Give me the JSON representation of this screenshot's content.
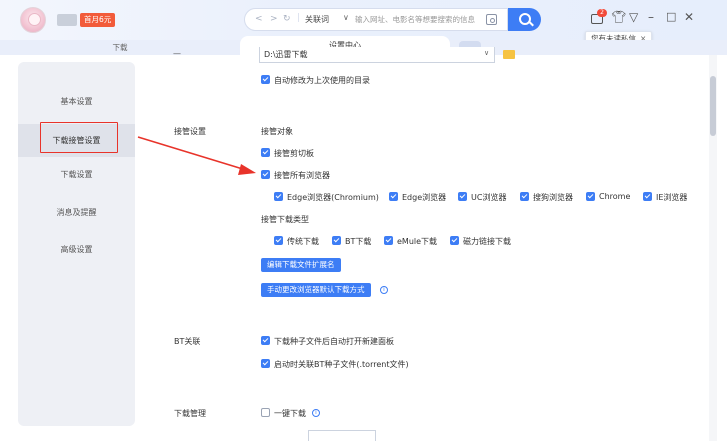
{
  "titlebar": {
    "vip_badge": "首月6元",
    "address": {
      "keyword_label": "关联词",
      "placeholder": "输入网址、电影名等想要搜索的信息"
    },
    "message_count": "2",
    "tooltip": "您有未读私信",
    "tooltip_close": "×"
  },
  "tabs": {
    "download": "下载",
    "settings": "设置中心"
  },
  "sidebar": {
    "items": [
      {
        "label": "基本设置"
      },
      {
        "label": "下载接管设置"
      },
      {
        "label": "下载设置"
      },
      {
        "label": "消息及提醒"
      },
      {
        "label": "高级设置"
      }
    ]
  },
  "content": {
    "dir_value": "D:\\迅雷下载",
    "auto_modify": "自动修改为上次使用的目录",
    "takeover_title": "接管设置",
    "takeover_target": "接管对象",
    "clipboard": "接管剪切板",
    "all_browsers": "接管所有浏览器",
    "browsers": [
      "Edge浏览器(Chromium)",
      "Edge浏览器",
      "UC浏览器",
      "搜狗浏览器",
      "Chrome",
      "IE浏览器"
    ],
    "download_types_title": "接管下载类型",
    "download_types": [
      "传统下载",
      "BT下载",
      "eMule下载",
      "磁力链接下载"
    ],
    "edit_ext_button": "编辑下载文件扩展名",
    "manual_change_button": "手动更改浏览器默认下载方式",
    "bt_title": "BT关联",
    "bt_options": [
      "下载种子文件后自动打开新建面板",
      "启动时关联BT种子文件(.torrent文件)"
    ],
    "download_mgmt_title": "下载管理",
    "one_click": "一键下载"
  },
  "colors": {
    "accent": "#3d7df5",
    "annotation_red": "#e8332a"
  }
}
